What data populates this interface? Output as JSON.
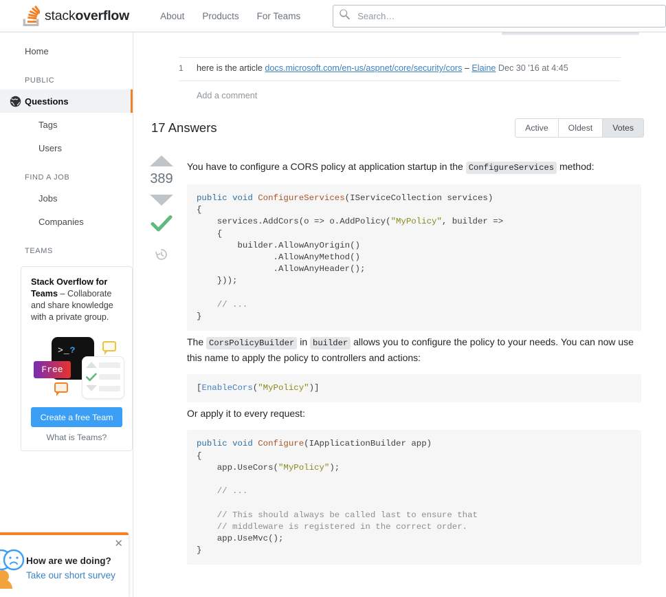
{
  "topbar": {
    "logo_text_light": "stack",
    "logo_text_bold": "overflow",
    "logo_icon": "stackoverflow-logo-icon",
    "nav": [
      {
        "label": "About",
        "name": "nav-about"
      },
      {
        "label": "Products",
        "name": "nav-products"
      },
      {
        "label": "For Teams",
        "name": "nav-for-teams"
      }
    ],
    "search": {
      "placeholder": "Search…",
      "value": "",
      "icon": "search-icon"
    }
  },
  "sidebar": {
    "home_label": "Home",
    "sections": [
      {
        "heading": "PUBLIC",
        "items": [
          {
            "label": "Questions",
            "active": true,
            "icon": "globe-icon"
          },
          {
            "label": "Tags",
            "active": false
          },
          {
            "label": "Users",
            "active": false
          }
        ]
      },
      {
        "heading": "FIND A JOB",
        "items": [
          {
            "label": "Jobs",
            "active": false
          },
          {
            "label": "Companies",
            "active": false
          }
        ]
      },
      {
        "heading": "TEAMS",
        "items": []
      }
    ],
    "teams_promo": {
      "title": "Stack Overflow for Teams",
      "body": " – Collaborate and share knowledge with a private group.",
      "free_badge": "Free",
      "terminal_glyph": ">_?",
      "cta_label": "Create a free Team",
      "link_label": "What is Teams?"
    },
    "survey": {
      "title": "How are we doing?",
      "link": "Take our short survey",
      "close_icon": "close-icon",
      "avatar_icon": "feedback-faces-icon"
    }
  },
  "main": {
    "comments": [
      {
        "score": "1",
        "prefix": "here is the article ",
        "link": "docs.microsoft.com/en-us/aspnet/core/security/cors",
        "dash": " – ",
        "user": "Elaine",
        "date": " Dec 30 '16 at 4:45"
      }
    ],
    "add_comment_label": "Add a comment",
    "answers_count_label": "17 Answers",
    "sort_tabs": [
      {
        "label": "Active",
        "selected": false
      },
      {
        "label": "Oldest",
        "selected": false
      },
      {
        "label": "Votes",
        "selected": true
      }
    ],
    "answer": {
      "vote_count": "389",
      "upvote_icon": "arrow-up-icon",
      "downvote_icon": "arrow-down-icon",
      "accepted_icon": "checkmark-icon",
      "history_icon": "history-clock-icon",
      "accent_green": "#5eba7d",
      "para1_a": "You have to configure a CORS policy at application startup in the ",
      "para1_code": "ConfigureServices",
      "para1_b": " method:",
      "code1": "public void ConfigureServices(IServiceCollection services)\n{\n    services.AddCors(o => o.AddPolicy(\"MyPolicy\", builder =>\n    {\n        builder.AllowAnyOrigin()\n               .AllowAnyMethod()\n               .AllowAnyHeader();\n    }));\n\n    // ...\n}",
      "para2_a": "The ",
      "para2_code1": "CorsPolicyBuilder",
      "para2_b": " in ",
      "para2_code2": "builder",
      "para2_c": " allows you to configure the policy to your needs. You can now use this name to apply the policy to controllers and actions:",
      "code2": "[EnableCors(\"MyPolicy\")]",
      "para3": "Or apply it to every request:",
      "code3": "public void Configure(IApplicationBuilder app)\n{\n    app.UseCors(\"MyPolicy\");\n\n    // ...\n\n    // This should always be called last to ensure that\n    // middleware is registered in the correct order.\n    app.UseMvc();\n}"
    }
  },
  "colors": {
    "orange": "#f48225",
    "link_blue": "#3b82c4",
    "teams_blue": "#3a9ff5",
    "accepted_green": "#5eba7d"
  }
}
